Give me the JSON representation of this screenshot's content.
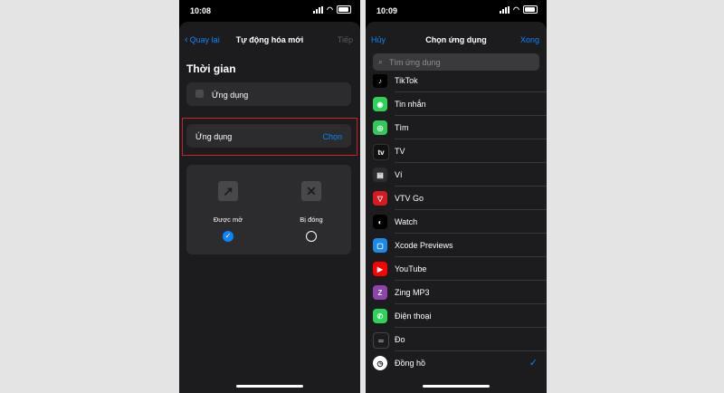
{
  "left_screen": {
    "status_time": "10:08",
    "nav": {
      "back_label": "Quay lại",
      "title": "Tự động hóa mới",
      "next_label": "Tiếp"
    },
    "section_title": "Thời gian",
    "trigger_card_label": "Ứng dụng",
    "app_picker": {
      "label": "Ứng dụng",
      "choose_label": "Chọn"
    },
    "states": [
      {
        "label": "Được mở",
        "icon": "arrow-up-right-icon",
        "selected": true
      },
      {
        "label": "Bị đóng",
        "icon": "x-icon",
        "selected": false
      }
    ]
  },
  "right_screen": {
    "status_time": "10:09",
    "nav": {
      "cancel_label": "Hủy",
      "title": "Chọn ứng dụng",
      "done_label": "Xong"
    },
    "search_placeholder": "Tìm ứng dụng",
    "apps": [
      {
        "name": "TikTok",
        "icon": "tiktok-icon",
        "color": "#000000"
      },
      {
        "name": "Tin nhắn",
        "icon": "messages-icon",
        "color": "#30d158"
      },
      {
        "name": "Tìm",
        "icon": "find-my-icon",
        "color": "#34c759"
      },
      {
        "name": "TV",
        "icon": "apple-tv-icon",
        "color": "#1c1c1e"
      },
      {
        "name": "Ví",
        "icon": "wallet-icon",
        "color": "#2c2c2e"
      },
      {
        "name": "VTV Go",
        "icon": "vtv-go-icon",
        "color": "#d71920"
      },
      {
        "name": "Watch",
        "icon": "watch-icon",
        "color": "#000000"
      },
      {
        "name": "Xcode Previews",
        "icon": "xcode-previews-icon",
        "color": "#1e88e5"
      },
      {
        "name": "YouTube",
        "icon": "youtube-icon",
        "color": "#ff0000"
      },
      {
        "name": "Zing MP3",
        "icon": "zing-mp3-icon",
        "color": "#8e44ad"
      },
      {
        "name": "Điện thoại",
        "icon": "phone-icon",
        "color": "#30d158"
      },
      {
        "name": "Đo",
        "icon": "measure-icon",
        "color": "#1c1c1e"
      },
      {
        "name": "Đồng hồ",
        "icon": "clock-icon",
        "color": "#ffffff",
        "selected": true
      }
    ]
  },
  "colors": {
    "accent": "#0a84ff",
    "highlight": "#d0202a",
    "sheet_bg": "#1c1c1e",
    "card_bg": "#2c2c2e"
  }
}
